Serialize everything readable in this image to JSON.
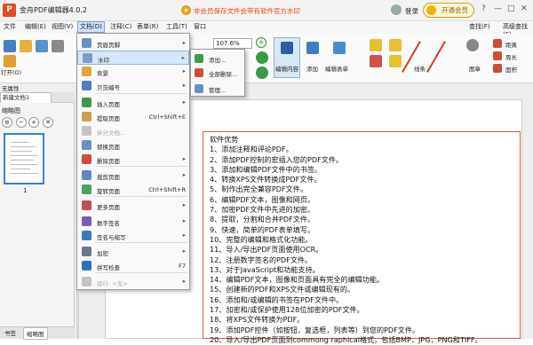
{
  "titlebar": {
    "app_title": "金舟PDF编辑器4.0.2",
    "promo_text": "非会员保存文件会带有软件官方水印",
    "login": "登录",
    "vip_button": "开通会员",
    "logo_glyph": "P",
    "window_controls": [
      "?",
      "—",
      "□",
      "✕"
    ]
  },
  "menubar": {
    "items": [
      "文件",
      "编辑(E)",
      "视图(V)",
      "文档(D)",
      "注释(C)",
      "表单(R)",
      "工具(T)",
      "窗口"
    ],
    "active_index": 3,
    "right_items": [
      "查找(F)",
      "高级查找(S)"
    ]
  },
  "ribbon": {
    "zoom_value": "107.6%",
    "labels": {
      "open": "打开(O)",
      "edit_content": "编辑内容",
      "add": "添加",
      "edit_form": "编辑表单",
      "line": "线条",
      "stamp": "图章",
      "distance": "距离",
      "perimeter": "周长",
      "area": "面积"
    }
  },
  "left_panel": {
    "properties_label": "无属性",
    "doc_tab": "新建文档1",
    "thumb_title": "缩略图",
    "page_number": "1",
    "bottom_tabs": [
      "书签",
      "缩略图"
    ]
  },
  "doc_menu": {
    "items": [
      {
        "label": "页眉页脚",
        "arrow": "▸",
        "icon": "header-footer-icon",
        "color": "#6a8fc5"
      },
      {
        "label": "水印",
        "arrow": "▸",
        "icon": "watermark-icon",
        "color": "#7a9ccc",
        "highlight": true
      },
      {
        "label": "背景",
        "arrow": "▸",
        "icon": "background-icon",
        "color": "#e5a53a"
      },
      {
        "label": "贝茨编号",
        "arrow": "▸",
        "icon": "bates-numbering-icon",
        "color": "#4f7ec0"
      },
      {
        "label": "插入页面",
        "arrow": "▸",
        "icon": "insert-page-icon",
        "color": "#3e9a4e"
      },
      {
        "label": "提取页面",
        "shortcut": "Ctrl+Shift+E",
        "icon": "extract-page-icon",
        "color": "#c9a04a"
      },
      {
        "label": "拆分文档...",
        "disabled": true,
        "icon": "split-document-icon",
        "color": "#c4c4c4"
      },
      {
        "label": "替换页面",
        "icon": "replace-page-icon",
        "color": "#6c8fc4"
      },
      {
        "label": "删除页面",
        "arrow": "▸",
        "icon": "delete-page-icon",
        "color": "#d04a3a"
      },
      {
        "label": "裁剪页面",
        "arrow": "▸",
        "icon": "crop-page-icon",
        "color": "#5b89c6"
      },
      {
        "label": "旋转页面",
        "shortcut": "Ctrl+Shift+R",
        "icon": "rotate-page-icon",
        "color": "#4aa35b"
      },
      {
        "label": "更多页面",
        "arrow": "▸",
        "icon": "more-pages-icon",
        "color": "#c05050"
      },
      {
        "label": "数字签名",
        "arrow": "▸",
        "icon": "digital-signature-icon",
        "color": "#7b5ac0"
      },
      {
        "label": "签名与缩写",
        "arrow": "▸",
        "icon": "sign-initials-icon",
        "color": "#3a7cc2"
      },
      {
        "label": "加密",
        "arrow": "▸",
        "icon": "encrypt-icon",
        "color": "#6c7a89"
      },
      {
        "label": "拼写检查",
        "shortcut": "F7",
        "icon": "spell-check-icon",
        "color": "#2f6fb8"
      },
      {
        "label": "运行: <无>",
        "arrow": "▸",
        "disabled": true,
        "icon": "run-action-icon",
        "color": "#c4c4c4"
      }
    ]
  },
  "watermark_submenu": {
    "items": [
      {
        "label": "添加...",
        "icon": "add-watermark-icon",
        "color": "#3e9a4e"
      },
      {
        "label": "全部删除...",
        "icon": "remove-all-watermark-icon",
        "color": "#d04a3a"
      },
      {
        "label": "管理...",
        "icon": "manage-watermark-icon",
        "color": "#6a8fc5"
      }
    ]
  },
  "document": {
    "lines": [
      "软件优势",
      "1、添加注释和评论PDF。",
      "2、添加PDF控制的宏插入您的PDF文件。",
      "3、添加和编辑PDF文件中的书签。",
      "4、转换XPS文件转换成PDF文件。",
      "5、制作出完全兼容PDF文件。",
      "6、编辑PDF文本，图像和网页。",
      "7、加密PDF文件中先进的加密。",
      "8、提取，分割和合并PDF文件。",
      "9、快速，简单的PDF表单填写。",
      "10、完整的编辑和格式化功能。",
      "11、导入/导出PDF页面使用OCR。",
      "12、注册数字签名的PDF文件。",
      "13、对于JavaScript和功能支持。",
      "14、编辑PDF文本，图像和页面具有完全的编辑功能。",
      "15、创建新的PDF和XPS文件或编辑现有的。",
      "16、添加和/或编辑的书签在PDF文件中。",
      "17、加密和/或保护使用128位加密的PDF文件。",
      "18、将XPS文件转换为PDF。",
      "19、添加PDF控件（如按钮，复选框，列表等）到您的PDF文件。",
      "20、导入/导出PDF页面到commong raphical格式，包括BMP，JPG，PNG和TIFF。"
    ]
  }
}
